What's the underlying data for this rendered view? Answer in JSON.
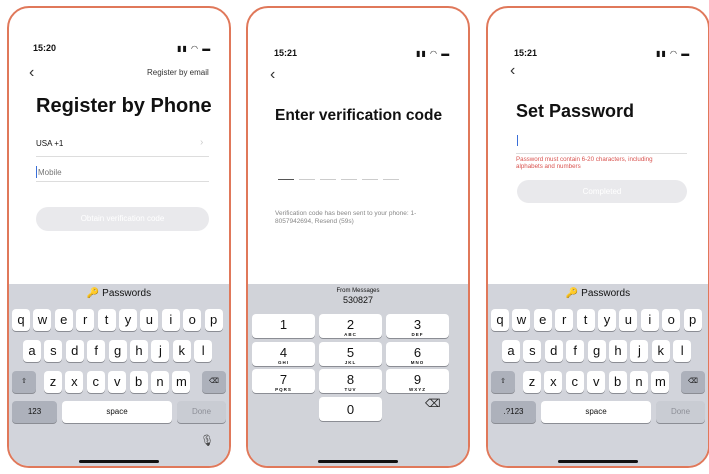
{
  "screen1": {
    "time": "15:20",
    "header_link": "Register by email",
    "title": "Register by Phone",
    "country": "USA +1",
    "mobile_placeholder": "Mobile",
    "button": "Obtain verification code",
    "keyboard": {
      "suggestion": "Passwords",
      "row1": [
        "q",
        "w",
        "e",
        "r",
        "t",
        "y",
        "u",
        "i",
        "o",
        "p"
      ],
      "row2": [
        "a",
        "s",
        "d",
        "f",
        "g",
        "h",
        "j",
        "k",
        "l"
      ],
      "row3": [
        "z",
        "x",
        "c",
        "v",
        "b",
        "n",
        "m"
      ],
      "numbers_key": "123",
      "space_key": "space",
      "done_key": "Done"
    }
  },
  "screen2": {
    "time": "15:21",
    "title": "Enter verification code",
    "sent_text": "Verification code has been sent to your phone: 1-8057942694, Resend (59s)",
    "suggestion_label": "From Messages",
    "suggestion_code": "530827",
    "numpad": [
      {
        "digit": "1",
        "letters": ""
      },
      {
        "digit": "2",
        "letters": "ABC"
      },
      {
        "digit": "3",
        "letters": "DEF"
      },
      {
        "digit": "4",
        "letters": "GHI"
      },
      {
        "digit": "5",
        "letters": "JKL"
      },
      {
        "digit": "6",
        "letters": "MNO"
      },
      {
        "digit": "7",
        "letters": "PQRS"
      },
      {
        "digit": "8",
        "letters": "TUV"
      },
      {
        "digit": "9",
        "letters": "WXYZ"
      },
      {
        "digit": "0",
        "letters": ""
      }
    ]
  },
  "screen3": {
    "time": "15:21",
    "title": "Set Password",
    "error": "Password must contain 6-20 characters, including alphabets and numbers",
    "button": "Completed",
    "keyboard": {
      "suggestion": "Passwords",
      "row1": [
        "q",
        "w",
        "e",
        "r",
        "t",
        "y",
        "u",
        "i",
        "o",
        "p"
      ],
      "row2": [
        "a",
        "s",
        "d",
        "f",
        "g",
        "h",
        "j",
        "k",
        "l"
      ],
      "row3": [
        "z",
        "x",
        "c",
        "v",
        "b",
        "n",
        "m"
      ],
      "numbers_key": ".?123",
      "space_key": "space",
      "done_key": "Done"
    }
  },
  "colors": {
    "frame": "#e0785a",
    "error": "#d9534f",
    "disabled_button": "#e9e9ec",
    "keyboard_bg": "#d2d4db"
  },
  "icons": [
    "back-chevron-icon",
    "signal-icon",
    "wifi-icon",
    "battery-icon",
    "key-icon",
    "shift-icon",
    "delete-icon",
    "microphone-icon",
    "chevron-right-icon"
  ]
}
